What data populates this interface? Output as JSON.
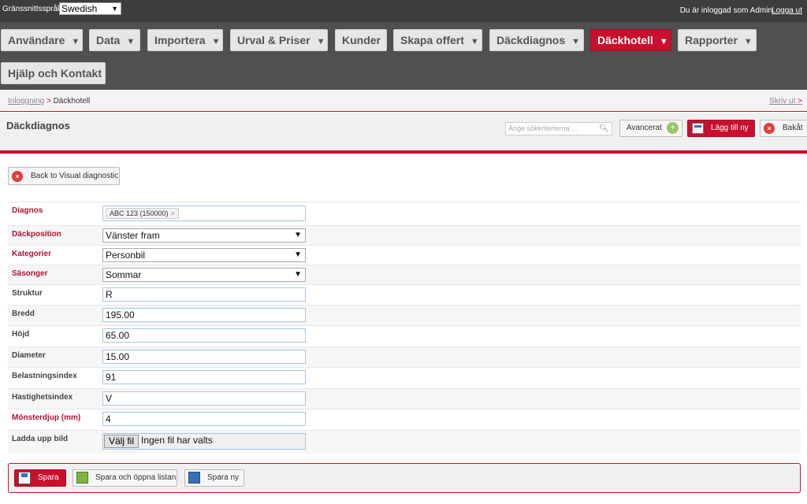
{
  "topbar": {
    "language_label": "Gränssnittsspråk",
    "language_value": "Swedish",
    "logged_in_text": "Du är inloggad som Admin",
    "logout_label": "Logga ut"
  },
  "nav": {
    "items": [
      {
        "label": "Användare"
      },
      {
        "label": "Data"
      },
      {
        "label": "Importera"
      },
      {
        "label": "Urval & Priser"
      },
      {
        "label": "Kunder"
      },
      {
        "label": "Skapa offert"
      },
      {
        "label": "Däckdiagnos"
      },
      {
        "label": "Däckhotell"
      },
      {
        "label": "Rapporter"
      },
      {
        "label": "Hjälp och Kontakt"
      }
    ],
    "active": "Däckhotell",
    "caret": "▼"
  },
  "breadcrumb": {
    "root": "Inloggning",
    "separator": ">",
    "current": "Däckhotell",
    "print_label": "Skriv ut",
    "print_sep": ">"
  },
  "header": {
    "title": "Däckdiagnos",
    "search_placeholder": "Ange sökkriterierna ...",
    "advanced_label": "Avancerat",
    "add_label": "Lägg till ny",
    "back_label": "Bakåt"
  },
  "visual_back_label": "Back to Visual diagnostic",
  "form": {
    "diagnos": {
      "label": "Diagnos",
      "token": "ABC 123 (150000)",
      "token_remove": "×"
    },
    "dackposition": {
      "label": "Däckposition",
      "value": "Vänster fram"
    },
    "kategorier": {
      "label": "Kategorier",
      "value": "Personbil"
    },
    "sasonger": {
      "label": "Säsonger",
      "value": "Sommar"
    },
    "struktur": {
      "label": "Struktur",
      "value": "R"
    },
    "bredd": {
      "label": "Bredd",
      "value": "195.00"
    },
    "hojd": {
      "label": "Höjd",
      "value": "65.00"
    },
    "diameter": {
      "label": "Diameter",
      "value": "15.00"
    },
    "belastningsindex": {
      "label": "Belastningsindex",
      "value": "91"
    },
    "hastighetsindex": {
      "label": "Hastighetsindex",
      "value": "V"
    },
    "monsterdjup": {
      "label": "Mönsterdjup (mm)",
      "value": "4"
    },
    "upload": {
      "label": "Ladda upp bild",
      "button": "Välj fil",
      "status": "Ingen fil har valts"
    }
  },
  "actions": {
    "save": "Spara",
    "save_open": "Spara och öppna listan",
    "save_new": "Spara ny"
  },
  "colors": {
    "accent": "#c8102e",
    "nav_bg": "#505050",
    "topbar_bg": "#3d3d3d"
  },
  "icons": [
    "search-icon",
    "zoom-icon",
    "add-icon",
    "close-icon",
    "save-icon",
    "list-icon",
    "new-icon"
  ]
}
